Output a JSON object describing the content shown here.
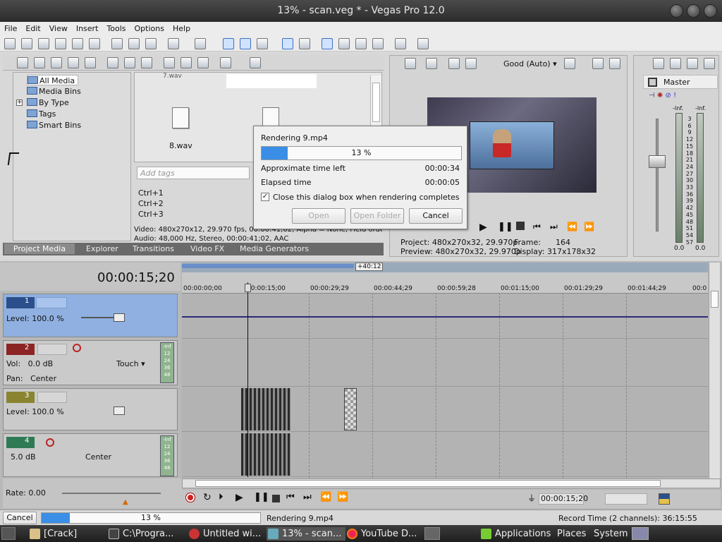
{
  "title": "13% - scan.veg * - Vegas Pro 12.0",
  "menu": [
    "File",
    "Edit",
    "View",
    "Insert",
    "Tools",
    "Options",
    "Help"
  ],
  "explorer": {
    "tree": [
      "All Media",
      "Media Bins",
      "By Type",
      "Tags",
      "Smart Bins"
    ],
    "files": {
      "top_label": "7.wav",
      "file8": "8.wav"
    },
    "tags_placeholder": "Add tags",
    "ctrl": [
      "Ctrl+1",
      "Ctrl+2",
      "Ctrl+3"
    ],
    "info_video": "Video: 480x270x12, 29.970 fps, 00:00:41;02, Alpha = None, Field order",
    "info_audio": "Audio: 48,000 Hz, Stereo, 00:00:41;02, AAC",
    "tabs": [
      "Project Media",
      "Explorer",
      "Transitions",
      "Video FX",
      "Media Generators"
    ]
  },
  "preview": {
    "quality": "Good (Auto)",
    "project_label": "Project:",
    "project_val": "480x270x32, 29.970p",
    "preview_label": "Preview:",
    "preview_val": "480x270x32, 29.970p",
    "frame_label": "Frame:",
    "frame_val": "164",
    "display_label": "Display:",
    "display_val": "317x178x32"
  },
  "mixer": {
    "title": "Master",
    "inf_left": "-Inf.",
    "inf_right": "-Inf.",
    "scale": [
      "3",
      "6",
      "9",
      "12",
      "15",
      "18",
      "21",
      "24",
      "27",
      "30",
      "33",
      "36",
      "39",
      "42",
      "45",
      "48",
      "51",
      "54",
      "57"
    ],
    "bottom_left": "0.0",
    "bottom_right": "0.0"
  },
  "dialog": {
    "title": "Rendering 9.mp4",
    "progress": 13,
    "progress_text": "13 %",
    "approx_label": "Approximate time left",
    "approx_val": "00:00:34",
    "elapsed_label": "Elapsed time",
    "elapsed_val": "00:00:05",
    "close_label": "Close this dialog box when rendering completes",
    "open": "Open",
    "open_folder": "Open Folder",
    "cancel": "Cancel"
  },
  "timeline": {
    "time": "00:00:15;20",
    "loop_len": "+40:12",
    "ruler": [
      "00:00:00;00",
      "00:00:15;00",
      "00:00:29;29",
      "00:00:44;29",
      "00:00:59;28",
      "00:01:15;00",
      "00:01:29;29",
      "00:01:44;29",
      "00:0"
    ],
    "tracks": [
      {
        "num": "1",
        "level_label": "Level:",
        "level": "100.0 %"
      },
      {
        "num": "2",
        "vol_label": "Vol:",
        "vol": "0.0 dB",
        "pan_label": "Pan:",
        "pan": "Center",
        "mode": "Touch",
        "meter": [
          "-Inf",
          "12",
          "24",
          "36",
          "48"
        ]
      },
      {
        "num": "3",
        "level_label": "Level:",
        "level": "100.0 %"
      },
      {
        "num": "4",
        "vol": "5.0 dB",
        "pan": "Center",
        "meter": [
          "-Inf",
          "12",
          "24",
          "36",
          "48"
        ]
      }
    ],
    "rate_label": "Rate: 0.00",
    "cursor_time": "00:00:15;20"
  },
  "status": {
    "cancel": "Cancel",
    "progress": 13,
    "progress_text": "13 %",
    "rendering": "Rendering 9.mp4",
    "record_time": "Record Time (2 channels): 36:15:55"
  },
  "taskbar": {
    "items": [
      "[Crack]",
      "C:\\Progra...",
      "Untitled wi...",
      "13% - scan...",
      "YouTube D..."
    ],
    "right": [
      "Applications",
      "Places",
      "System"
    ]
  },
  "colors": {
    "accent": "#3a8ee6",
    "track1": "#2b4f8c",
    "track2": "#8c2424",
    "track3": "#8a8430",
    "track4": "#2e7a54",
    "progress": "#3a8ee6"
  }
}
